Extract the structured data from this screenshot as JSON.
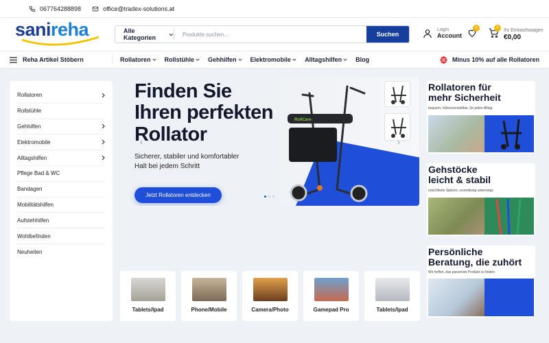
{
  "topbar": {
    "phone": "067764288898",
    "email": "office@tradex-solutions.at"
  },
  "logo": {
    "part1": "sani",
    "part2": "reha"
  },
  "search": {
    "category": "Alle Kategorien",
    "placeholder": "Produkte suchen...",
    "button": "Suchen"
  },
  "account": {
    "line1": "Login",
    "line2": "Account"
  },
  "wishlist": {
    "count": "0"
  },
  "cart": {
    "count": "0",
    "line1": "Ihr Einkaufswagen",
    "line2": "€0,00"
  },
  "nav": {
    "browse": "Reha Artikel Stöbern",
    "links": [
      "Rollatoren",
      "Rollstühle",
      "Gehhilfen",
      "Elektromobile",
      "Alltagshilfen",
      "Blog"
    ],
    "promo": "Minus 10% auf alle Rollatoren"
  },
  "sidebar": {
    "items": [
      {
        "label": "Rollatoren",
        "arrow": true
      },
      {
        "label": "Rollstühle",
        "arrow": false
      },
      {
        "label": "Gehhilfen",
        "arrow": true
      },
      {
        "label": "Elektromobile",
        "arrow": true
      },
      {
        "label": "Alltagshilfen",
        "arrow": true
      },
      {
        "label": "Pflege Bad & WC",
        "arrow": false
      },
      {
        "label": "Bandagen",
        "arrow": false
      },
      {
        "label": "Mobilitätshilfen",
        "arrow": false
      },
      {
        "label": "Aufstehhilfen",
        "arrow": false
      },
      {
        "label": "Wohlbefinden",
        "arrow": false
      },
      {
        "label": "Neuheiten",
        "arrow": false
      }
    ]
  },
  "hero": {
    "title_line1": "Finden Sie",
    "title_line2": "Ihren perfekten",
    "title_line3": "Rollator",
    "subtitle_line1": "Sicherer, stabiler und komfortabler",
    "subtitle_line2": "Halt bei jedem Schritt",
    "cta": "Jetzt Rollatoren entdecken",
    "product_brand": "RollCare"
  },
  "promos": [
    {
      "title_line1": "Rollatoren für",
      "title_line2": "mehr Sicherheit",
      "small": "bequem, höhenverstellbar, für jeden Alltag"
    },
    {
      "title_line1": "Gehstöcke",
      "title_line2": "leicht & stabil",
      "small": "rutschfeste Spitzen, zuverlässig unterwegs"
    },
    {
      "title_line1": "Persönliche",
      "title_line2": "Beratung, die zuhört",
      "small": "Wir helfen, das passende Produkt zu finden"
    }
  ],
  "categories": [
    {
      "label": "Tablets/Ipad"
    },
    {
      "label": "Phone/Mobile"
    },
    {
      "label": "Camera/Photo"
    },
    {
      "label": "Gamepad Pro"
    },
    {
      "label": "Tablets/Ipad"
    }
  ],
  "colors": {
    "primary": "#163e9c",
    "accent_blue": "#1f4fd8",
    "badge": "#f2b705",
    "promo_red": "#e03a3a",
    "background": "#eef1f5"
  }
}
